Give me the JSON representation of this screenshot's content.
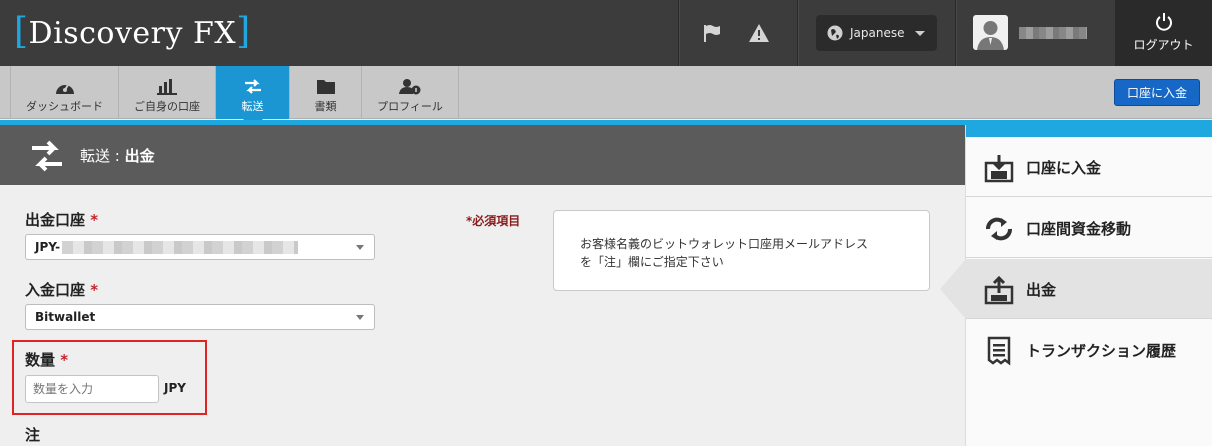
{
  "header": {
    "logo_text": "Discovery FX",
    "language": "Japanese",
    "logout_label": "ログアウト"
  },
  "tabs": [
    {
      "label": "ダッシュボード",
      "icon": "dashboard-icon"
    },
    {
      "label": "ご自身の口座",
      "icon": "bar-chart-icon"
    },
    {
      "label": "転送",
      "icon": "transfer-icon"
    },
    {
      "label": "書類",
      "icon": "folder-icon"
    },
    {
      "label": "プロフィール",
      "icon": "profile-icon"
    }
  ],
  "deposit_button": "口座に入金",
  "page_title": {
    "prefix": "転送 : ",
    "strong": "出金"
  },
  "form": {
    "required_note": "*必須項目",
    "from_account_label": "出金口座",
    "from_account_value": "JPY-",
    "to_account_label": "入金口座",
    "to_account_value": "Bitwallet",
    "amount_label": "数量",
    "amount_placeholder": "数量を入力",
    "amount_unit": "JPY",
    "note_label": "注",
    "star": "*"
  },
  "notice": {
    "line1": "お客様名義のビットウォレット口座用メールアドレス",
    "line2": "を「注」欄にご指定下さい"
  },
  "side_menu": [
    {
      "label": "口座に入金",
      "icon": "deposit-icon"
    },
    {
      "label": "口座間資金移動",
      "icon": "internal-transfer-icon"
    },
    {
      "label": "出金",
      "icon": "withdraw-icon"
    },
    {
      "label": "トランザクション履歴",
      "icon": "receipt-icon"
    }
  ],
  "colors": {
    "accent": "#1fa7e0",
    "header_bg": "#3c3c3c",
    "button_blue": "#1768c6",
    "required_red": "#c0272d"
  }
}
